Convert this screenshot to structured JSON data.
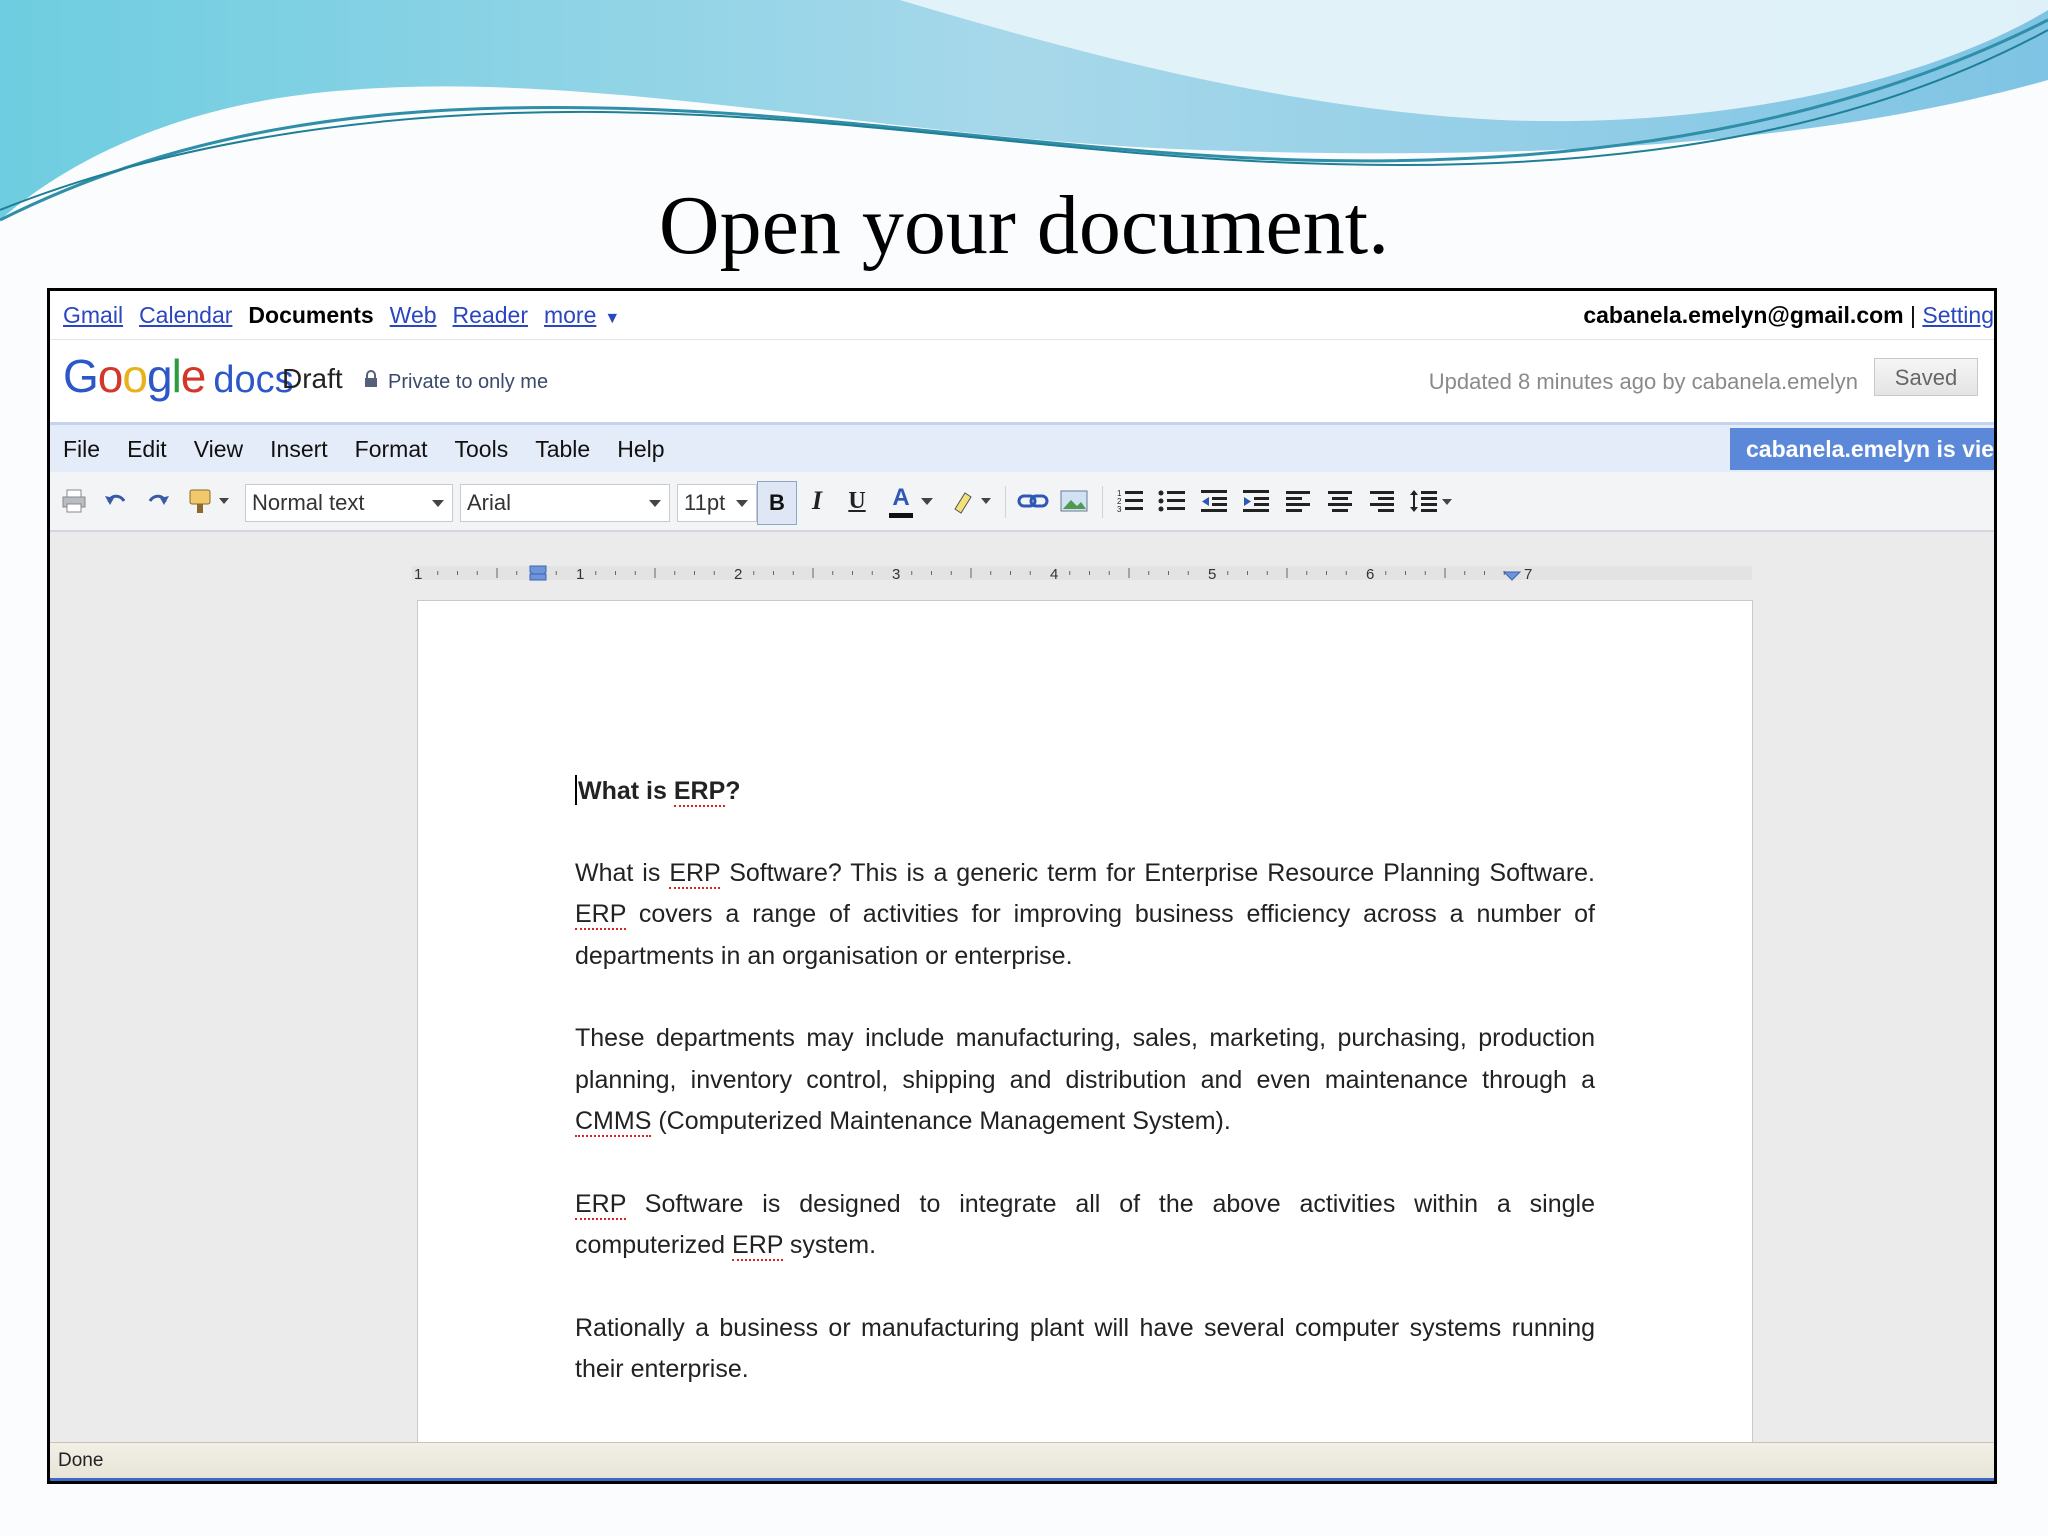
{
  "slide": {
    "title": "Open your document."
  },
  "gbar": {
    "links": [
      "Gmail",
      "Calendar",
      "Documents",
      "Web",
      "Reader",
      "more"
    ],
    "current": "Documents",
    "email": "cabanela.emelyn@gmail.com",
    "separator": "|",
    "settings": "Setting"
  },
  "header": {
    "logo_word": "Google",
    "logo_product": "docs",
    "doc_title": "Draft",
    "privacy": "Private to only me",
    "updated": "Updated 8 minutes ago by cabanela.emelyn",
    "saved_label": "Saved"
  },
  "menubar": {
    "items": [
      "File",
      "Edit",
      "View",
      "Insert",
      "Format",
      "Tools",
      "Table",
      "Help"
    ],
    "viewer_badge": "cabanela.emelyn is view"
  },
  "toolbar": {
    "style_value": "Normal text",
    "font_value": "Arial",
    "size_value": "11pt",
    "bold": "B",
    "italic": "I",
    "underline": "U",
    "text_color_letter": "A",
    "icons": [
      "print-icon",
      "undo-icon",
      "redo-icon",
      "paint-format-icon",
      "link-icon",
      "image-icon",
      "numbered-list-icon",
      "bulleted-list-icon",
      "decrease-indent-icon",
      "increase-indent-icon",
      "align-left-icon",
      "align-center-icon",
      "align-right-icon",
      "line-spacing-icon"
    ]
  },
  "ruler": {
    "labels": [
      "1",
      "1",
      "2",
      "3",
      "4",
      "5",
      "6",
      "7"
    ]
  },
  "document": {
    "heading": "What is ERP?",
    "p1": "What is ERP Software? This is a generic term for Enterprise Resource Planning Software. ERP covers a range of activities for improving business efficiency across a number of departments in an organisation or enterprise.",
    "p2": "These departments may include manufacturing, sales, marketing, purchasing, production planning, inventory control, shipping and distribution and even maintenance through a CMMS (Computerized Maintenance Management System).",
    "p3": "ERP Software is designed to integrate all of the above activities within a single computerized ERP system.",
    "p4": "Rationally a business or manufacturing plant will have several computer systems running their enterprise."
  },
  "status": {
    "text": "Done"
  },
  "colors": {
    "link": "#2a46c0",
    "menubar_bg": "#e5ecf9",
    "viewer_badge_bg": "#5b88d8",
    "status_bar_bg": "#ece9dc"
  }
}
